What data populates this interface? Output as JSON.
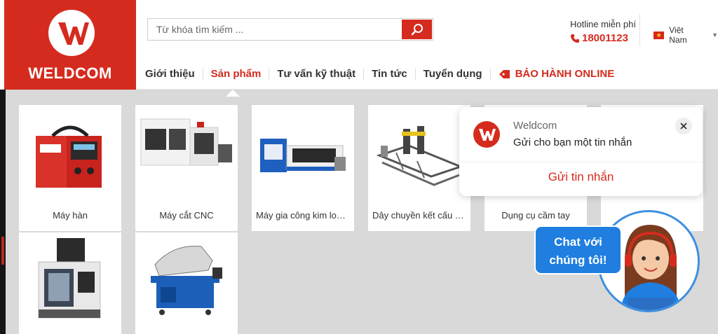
{
  "brand": {
    "name": "WELDCOM",
    "color": "#d52b1e"
  },
  "search": {
    "placeholder": "Từ khóa tìm kiếm ...",
    "icon": "search-icon"
  },
  "hotline": {
    "label": "Hotline miễn phí",
    "number": "18001123",
    "icon": "phone-icon"
  },
  "language": {
    "selected": "Việt Nam",
    "icon": "vietnam-flag-icon"
  },
  "nav": {
    "items": [
      "Giới thiệu",
      "Sản phẩm",
      "Tư vấn kỹ thuật",
      "Tin tức",
      "Tuyển dụng"
    ],
    "active": "Sản phẩm",
    "warranty": "BẢO HÀNH ONLINE"
  },
  "products": [
    {
      "label": "Máy hàn",
      "icon": "welding-machine-icon"
    },
    {
      "label": "Máy cắt CNC",
      "icon": "cnc-cutter-icon"
    },
    {
      "label": "Máy gia công kim loại ...",
      "icon": "laser-machine-icon"
    },
    {
      "label": "Dây chuyền kết cấu thép",
      "icon": "steel-line-icon"
    },
    {
      "label": "Dụng cụ cầm tay",
      "icon": "hand-tool-icon"
    },
    {
      "label": "",
      "icon": "machining-center-icon"
    },
    {
      "label": "",
      "icon": "band-saw-icon"
    }
  ],
  "messenger_popup": {
    "title": "Weldcom",
    "message": "Gửi cho bạn một tin nhắn",
    "button": "Gửi tin nhắn"
  },
  "chat_widget": {
    "line1": "Chat với",
    "line2": "chúng tôi!"
  }
}
